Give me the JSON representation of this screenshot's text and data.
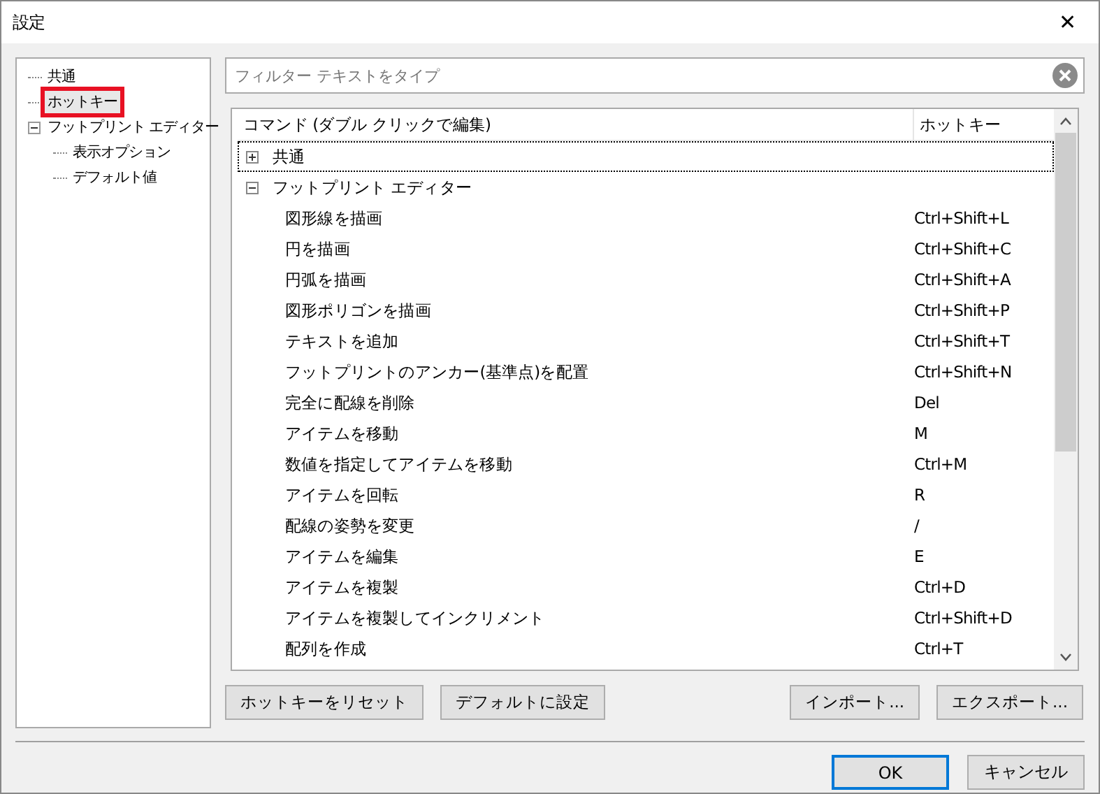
{
  "window": {
    "title": "設定",
    "close": "✕"
  },
  "tree": [
    {
      "label": "共通",
      "selected": false,
      "marked": false
    },
    {
      "label": "ホットキー",
      "selected": true,
      "marked": true
    },
    {
      "label": "フットプリント エディター",
      "selected": false,
      "marked": false,
      "expanded": true,
      "children": [
        {
          "label": "表示オプション",
          "selected": false,
          "marked": false
        },
        {
          "label": "デフォルト値",
          "selected": false,
          "marked": false
        }
      ]
    }
  ],
  "filter": {
    "placeholder": "フィルター テキストをタイプ"
  },
  "table": {
    "columns": [
      "コマンド (ダブル クリックで編集)",
      "ホットキー"
    ],
    "groups": [
      {
        "label": "共通",
        "expanded": false,
        "focused": true
      },
      {
        "label": "フットプリント エディター",
        "expanded": true,
        "focused": false,
        "rows": [
          {
            "command": "図形線を描画",
            "hotkey": "Ctrl+Shift+L"
          },
          {
            "command": "円を描画",
            "hotkey": "Ctrl+Shift+C"
          },
          {
            "command": "円弧を描画",
            "hotkey": "Ctrl+Shift+A"
          },
          {
            "command": "図形ポリゴンを描画",
            "hotkey": "Ctrl+Shift+P"
          },
          {
            "command": "テキストを追加",
            "hotkey": "Ctrl+Shift+T"
          },
          {
            "command": "フットプリントのアンカー(基準点)を配置",
            "hotkey": "Ctrl+Shift+N"
          },
          {
            "command": "完全に配線を削除",
            "hotkey": "Del"
          },
          {
            "command": "アイテムを移動",
            "hotkey": "M"
          },
          {
            "command": "数値を指定してアイテムを移動",
            "hotkey": "Ctrl+M"
          },
          {
            "command": "アイテムを回転",
            "hotkey": "R"
          },
          {
            "command": "配線の姿勢を変更",
            "hotkey": "/"
          },
          {
            "command": "アイテムを編集",
            "hotkey": "E"
          },
          {
            "command": "アイテムを複製",
            "hotkey": "Ctrl+D"
          },
          {
            "command": "アイテムを複製してインクリメント",
            "hotkey": "Ctrl+Shift+D"
          },
          {
            "command": "配列を作成",
            "hotkey": "Ctrl+T"
          }
        ]
      }
    ]
  },
  "left_buttons": [
    "ホットキーをリセット",
    "デフォルトに設定"
  ],
  "right_buttons": [
    "インポート...",
    "エクスポート..."
  ],
  "dialog_buttons": [
    {
      "label": "OK",
      "default": true
    },
    {
      "label": "キャンセル",
      "default": false
    }
  ]
}
